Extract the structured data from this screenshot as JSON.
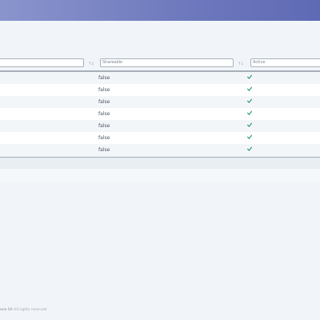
{
  "filters": {
    "shareable_placeholder": "Shareable",
    "active_placeholder": "Active",
    "sort_icon": "sort-arrows-icon",
    "sort_glyph": "↑↓"
  },
  "table": {
    "rows": [
      {
        "shareable": "false",
        "active": true
      },
      {
        "shareable": "false",
        "active": true
      },
      {
        "shareable": "false",
        "active": true
      },
      {
        "shareable": "false",
        "active": true
      },
      {
        "shareable": "false",
        "active": true
      },
      {
        "shareable": "false",
        "active": true
      },
      {
        "shareable": "false",
        "active": true
      }
    ],
    "check_color": "#2f9e6e"
  },
  "footer": {
    "brand": "one SA",
    "text": " All rights reserved"
  },
  "colors": {
    "header_gradient_start": "#8a94cc",
    "header_gradient_end": "#5f6ab5",
    "page_background": "#f1f5f9"
  }
}
